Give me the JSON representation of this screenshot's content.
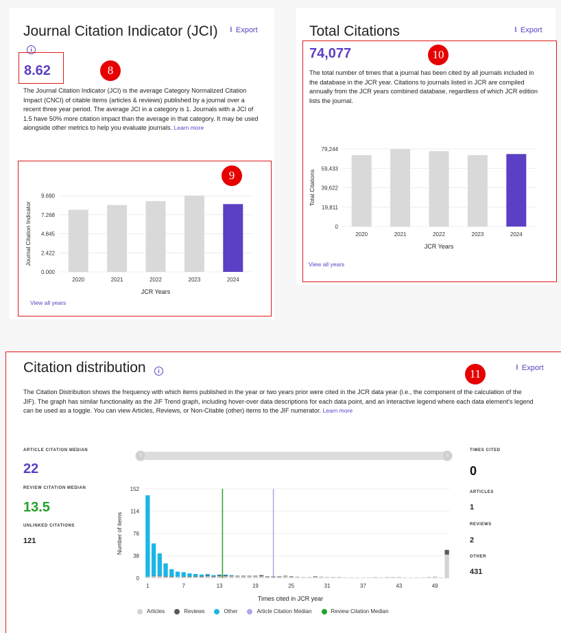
{
  "jci": {
    "title": "Journal Citation Indicator (JCI)",
    "export_label": "Export",
    "value": "8.62",
    "description": "The Journal Citation Indicator (JCI) is the average Category Normalized Citation Impact (CNCI) of citable items (articles & reviews) published by a journal over a recent three year period. The average JCI in a category is 1. Journals with a JCI of 1.5 have 50% more citation impact than the average in that category. It may be used alongside other metrics to help you evaluate journals.",
    "learn_more": "Learn more",
    "view_all": "View all years",
    "badge_value": "8",
    "chart_badge": "9"
  },
  "total": {
    "title": "Total Citations",
    "export_label": "Export",
    "value": "74,077",
    "description": "The total number of times that a journal has been cited by all journals included in the database in the JCR year. Citations to journals listed in JCR are compiled annually from the JCR years combined database, regardless of which JCR edition lists the journal.",
    "view_all": "View all years",
    "badge": "10"
  },
  "dist": {
    "title": "Citation distribution",
    "export_label": "Export",
    "badge": "11",
    "description": "The Citation Distribution shows the frequency with which items published in the year or two years prior were cited in the JCR data year (i.e., the component of the calculation of the JIF). The graph has similar functionality as the JIF Trend graph, including hover-over data descriptions for each data point, and an interactive legend where each data element's legend can be used as a toggle. You can view Articles, Reviews, or Non-Citable (other) items to the JIF numerator.",
    "learn_more": "Learn more",
    "article_median_label": "ARTICLE CITATION MEDIAN",
    "article_median_value": "22",
    "review_median_label": "REVIEW CITATION MEDIAN",
    "review_median_value": "13.5",
    "unlinked_label": "UNLINKED CITATIONS",
    "unlinked_value": "121",
    "times_cited_label": "TIMES CITED",
    "times_cited_value": "0",
    "articles_label": "ARTICLES",
    "articles_value": "1",
    "reviews_label": "REVIEWS",
    "reviews_value": "2",
    "other_label": "OTHER",
    "other_value": "431",
    "slider_min_handle": "0",
    "slider_max_handle": "0",
    "legend": [
      "Articles",
      "Reviews",
      "Other",
      "Article Citation Median",
      "Review Citation Median"
    ]
  },
  "colors": {
    "accent": "#5b3fc4",
    "bar_gray": "#d9d9d9",
    "articles": "#d3d3d3",
    "reviews": "#5a5a5a",
    "other": "#1ab6e6",
    "article_median": "#b3a3e8",
    "review_median": "#24a02a",
    "badge_red": "#e60000"
  },
  "chart_data": [
    {
      "type": "bar",
      "categories": [
        "2020",
        "2021",
        "2022",
        "2023",
        "2024"
      ],
      "values": [
        7.9,
        8.5,
        9.0,
        9.69,
        8.62
      ],
      "ylabel": "Journal Citation Indicator",
      "xlabel": "JCR Years",
      "yticks": [
        "0.000",
        "2.422",
        "4.845",
        "7.268",
        "9.690"
      ],
      "ylim": [
        0,
        9.69
      ],
      "highlight": "2024"
    },
    {
      "type": "bar",
      "categories": [
        "2020",
        "2021",
        "2022",
        "2023",
        "2024"
      ],
      "values": [
        73000,
        79244,
        77000,
        73000,
        74077
      ],
      "ylabel": "Total Citations",
      "xlabel": "JCR Years",
      "yticks": [
        "0",
        "19,811",
        "39,622",
        "59,433",
        "79,244"
      ],
      "ylim": [
        0,
        79244
      ],
      "highlight": "2024"
    },
    {
      "type": "bar",
      "xlabel": "Times cited in JCR year",
      "ylabel": "Number of items",
      "yticks": [
        "0",
        "38",
        "76",
        "114",
        "152"
      ],
      "ylim": [
        0,
        152
      ],
      "xticks": [
        "1",
        "7",
        "13",
        "19",
        "25",
        "31",
        "37",
        "43",
        "49"
      ],
      "x": [
        1,
        2,
        3,
        4,
        5,
        6,
        7,
        8,
        9,
        10,
        11,
        12,
        13,
        14,
        15,
        16,
        17,
        18,
        19,
        20,
        21,
        22,
        23,
        24,
        25,
        26,
        27,
        28,
        29,
        30,
        31,
        32,
        33,
        34,
        35,
        36,
        37,
        38,
        39,
        40,
        41,
        42,
        43,
        44,
        45,
        46,
        47,
        48,
        49,
        50,
        51
      ],
      "series": [
        {
          "name": "Articles",
          "values": [
            2,
            3,
            3,
            2,
            2,
            2,
            2,
            2,
            2,
            2,
            3,
            2,
            3,
            3,
            3,
            3,
            3,
            3,
            3,
            3,
            2,
            2,
            2,
            3,
            2,
            3,
            2,
            2,
            2,
            3,
            2,
            2,
            2,
            1,
            1,
            1,
            1,
            1,
            2,
            1,
            2,
            2,
            2,
            1,
            1,
            1,
            1,
            2,
            3,
            1,
            40
          ]
        },
        {
          "name": "Reviews",
          "values": [
            0,
            1,
            1,
            1,
            1,
            0,
            1,
            1,
            1,
            1,
            2,
            1,
            2,
            2,
            1,
            1,
            1,
            1,
            1,
            2,
            1,
            1,
            1,
            1,
            1,
            0,
            0,
            0,
            1,
            0,
            0,
            0,
            0,
            0,
            0,
            0,
            0,
            0,
            0,
            0,
            0,
            0,
            0,
            0,
            0,
            0,
            0,
            0,
            0,
            0,
            8
          ]
        },
        {
          "name": "Other",
          "values": [
            139,
            55,
            38,
            22,
            12,
            9,
            7,
            5,
            4,
            3,
            2,
            2,
            1,
            1,
            1,
            0,
            0,
            0,
            0,
            0,
            0,
            0,
            0,
            0,
            0,
            0,
            0,
            0,
            0,
            0,
            0,
            0,
            0,
            0,
            0,
            0,
            0,
            0,
            0,
            0,
            0,
            0,
            0,
            0,
            0,
            0,
            0,
            0,
            0,
            0,
            0
          ]
        }
      ],
      "medians": {
        "article": 22,
        "review": 13.5
      }
    }
  ]
}
